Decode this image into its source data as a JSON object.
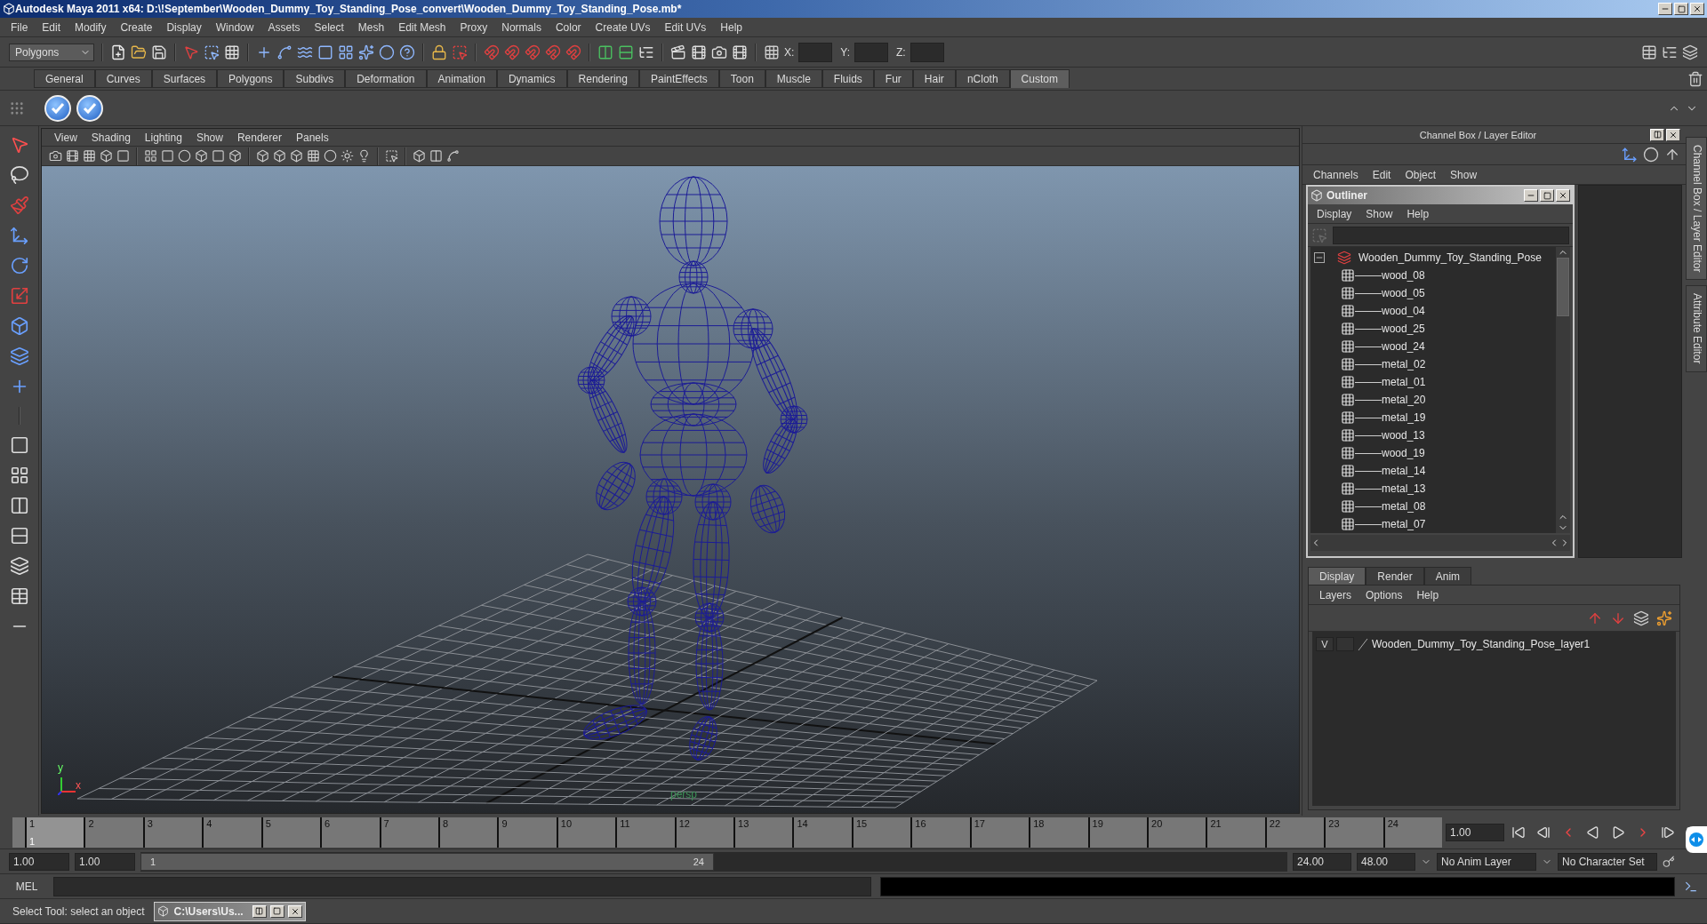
{
  "window": {
    "title": "Autodesk Maya 2011 x64: D:\\!September\\Wooden_Dummy_Toy_Standing_Pose_convert\\Wooden_Dummy_Toy_Standing_Pose.mb*"
  },
  "menu_bar": [
    "File",
    "Edit",
    "Modify",
    "Create",
    "Display",
    "Window",
    "Assets",
    "Select",
    "Mesh",
    "Edit Mesh",
    "Proxy",
    "Normals",
    "Color",
    "Create UVs",
    "Edit UVs",
    "Help"
  ],
  "status_line": {
    "menu_set": "Polygons",
    "x_label": "X:",
    "y_label": "Y:",
    "z_label": "Z:"
  },
  "shelf": {
    "tabs": [
      {
        "label": "General",
        "selected": false
      },
      {
        "label": "Curves",
        "selected": false
      },
      {
        "label": "Surfaces",
        "selected": false
      },
      {
        "label": "Polygons",
        "selected": false
      },
      {
        "label": "Subdivs",
        "selected": false
      },
      {
        "label": "Deformation",
        "selected": false
      },
      {
        "label": "Animation",
        "selected": false
      },
      {
        "label": "Dynamics",
        "selected": false
      },
      {
        "label": "Rendering",
        "selected": false
      },
      {
        "label": "PaintEffects",
        "selected": false
      },
      {
        "label": "Toon",
        "selected": false
      },
      {
        "label": "Muscle",
        "selected": false
      },
      {
        "label": "Fluids",
        "selected": false
      },
      {
        "label": "Fur",
        "selected": false
      },
      {
        "label": "Hair",
        "selected": false
      },
      {
        "label": "nCloth",
        "selected": false
      },
      {
        "label": "Custom",
        "selected": true
      }
    ]
  },
  "viewport": {
    "menu": [
      "View",
      "Shading",
      "Lighting",
      "Show",
      "Renderer",
      "Panels"
    ],
    "axis": {
      "y": "y",
      "x": "x"
    },
    "camera": "persp"
  },
  "channel_box": {
    "title": "Channel Box / Layer Editor",
    "menu": [
      "Channels",
      "Edit",
      "Object",
      "Show"
    ]
  },
  "outliner": {
    "title": "Outliner",
    "menu": [
      "Display",
      "Show",
      "Help"
    ],
    "tree": [
      {
        "label": "Wooden_Dummy_Toy_Standing_Pose",
        "expanded": true,
        "children": [
          {
            "label": "wood_08"
          },
          {
            "label": "wood_05"
          },
          {
            "label": "wood_04"
          },
          {
            "label": "wood_25"
          },
          {
            "label": "wood_24"
          },
          {
            "label": "metal_02"
          },
          {
            "label": "metal_01"
          },
          {
            "label": "metal_20"
          },
          {
            "label": "metal_19"
          },
          {
            "label": "wood_13"
          },
          {
            "label": "wood_19"
          },
          {
            "label": "metal_14"
          },
          {
            "label": "metal_13"
          },
          {
            "label": "metal_08"
          },
          {
            "label": "metal_07"
          }
        ]
      }
    ]
  },
  "layer_editor": {
    "tabs": [
      {
        "label": "Display",
        "selected": true
      },
      {
        "label": "Render",
        "selected": false
      },
      {
        "label": "Anim",
        "selected": false
      }
    ],
    "menu": [
      "Layers",
      "Options",
      "Help"
    ],
    "layers": [
      {
        "visibility": "V",
        "name": "Wooden_Dummy_Toy_Standing_Pose_layer1"
      }
    ]
  },
  "side_tabs": [
    "Channel Box / Layer Editor",
    "Attribute Editor"
  ],
  "timeline": {
    "ticks": [
      {
        "label": "1",
        "selected": true
      },
      {
        "label": "2",
        "selected": false
      },
      {
        "label": "3",
        "selected": false
      },
      {
        "label": "4",
        "selected": false
      },
      {
        "label": "5",
        "selected": false
      },
      {
        "label": "6",
        "selected": false
      },
      {
        "label": "7",
        "selected": false
      },
      {
        "label": "8",
        "selected": false
      },
      {
        "label": "9",
        "selected": false
      },
      {
        "label": "10",
        "selected": false
      },
      {
        "label": "11",
        "selected": false
      },
      {
        "label": "12",
        "selected": false
      },
      {
        "label": "13",
        "selected": false
      },
      {
        "label": "14",
        "selected": false
      },
      {
        "label": "15",
        "selected": false
      },
      {
        "label": "16",
        "selected": false
      },
      {
        "label": "17",
        "selected": false
      },
      {
        "label": "18",
        "selected": false
      },
      {
        "label": "19",
        "selected": false
      },
      {
        "label": "20",
        "selected": false
      },
      {
        "label": "21",
        "selected": false
      },
      {
        "label": "22",
        "selected": false
      },
      {
        "label": "23",
        "selected": false
      },
      {
        "label": "24",
        "selected": false
      }
    ],
    "current_frame": "1",
    "current_time": "1.00"
  },
  "range": {
    "level": 0.5,
    "start": "1.00",
    "playback_start": "1.00",
    "slider_start": "1",
    "slider_end": "24",
    "playback_end": "24.00",
    "end": "48.00",
    "anim_layer": "No Anim Layer",
    "character_set": "No Character Set"
  },
  "command_line": {
    "label": "MEL"
  },
  "help_line": {
    "text": "Select Tool: select an object"
  },
  "minimized_window": {
    "title": "C:\\Users\\Us..."
  }
}
